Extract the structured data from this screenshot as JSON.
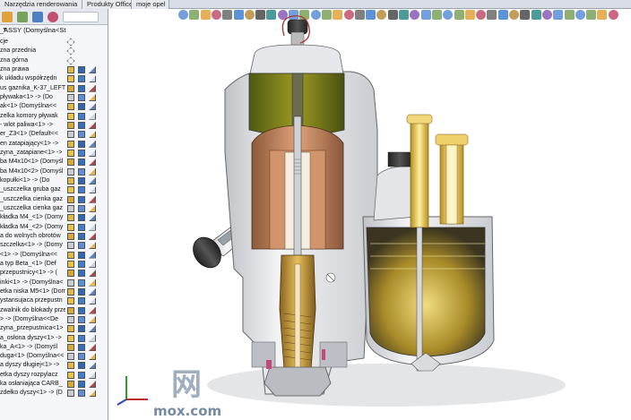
{
  "tabs": [
    "Narzędzia renderowania",
    "Produkty Office",
    "moje opel"
  ],
  "feature_tree": {
    "root_label": "_ASSY  (Domyślna<St",
    "items": [
      "cje",
      "zna przednia",
      "zna górna",
      "zna prawa",
      "k układu współrzędn",
      "us gaznika_K-37_LEFT",
      "pływaka<1> -> (Do",
      "ak<1> (Domyślna<<",
      "zelka komory pływak",
      "- wlot paliwa<1> ->",
      "er_Z3<1> (Default<<",
      "en zatapiający<1> ->",
      "zyna_zatapiane<1> ->",
      "ba M4x10<1> (Domyśl",
      "ba M4x10<2> (Domyśl",
      "kopułki<1> -> (Do",
      "_uszczelka gruba gaz",
      "_uszczelka cienka gaz",
      "_uszczelka cienka gaz",
      "kładka M4_<1> (Domy",
      "kładka M4_<2> (Domy",
      "a do wolnych obrotów",
      "szczelka<1> -> (Domy",
      "<1> -> (Domyślna<<",
      "a typ Beta_<1> (Def",
      "przepustnicy<1> -> (",
      "inki<1> -> (Domyślna<",
      "etka niska M5<1> (Dom",
      "ystansujaca przepustn",
      "zwalnik do blokady przepus",
      "> -> (Domyślna<<De",
      "zyna_przepustnica<1>",
      "a_osłona dyszy<1> ->",
      "ka_A<1> -> (Domyśl",
      "duga<1> (Domyślna<<",
      "a dyszy długiej<1> ->",
      "etka dyszy rozpylacz",
      "ka osłaniająca CARB_",
      "zdełko dyszy<1> -> (D"
    ]
  },
  "icons": {
    "panel_tabs": [
      "feature-manager-icon",
      "property-manager-icon",
      "configuration-manager-icon",
      "appearance-icon"
    ],
    "viewport_toolbar": [
      "zoom-to-fit-icon",
      "zoom-area-icon",
      "previous-view-icon",
      "section-view-icon",
      "view-orientation-icon",
      "display-style-icon",
      "hide-show-icon",
      "edit-appearance-icon",
      "scene-icon",
      "view-settings-icon"
    ]
  },
  "watermark": {
    "main": "网",
    "sub": "mox.com"
  },
  "colors": {
    "housing": "#e9e9ea",
    "brass": "#c89a3a",
    "copper": "#b8805a",
    "float_chamber_green": "#8a8a2a",
    "gold_needle": "#e6c34a",
    "panel_bg": "#f4f6fa"
  }
}
